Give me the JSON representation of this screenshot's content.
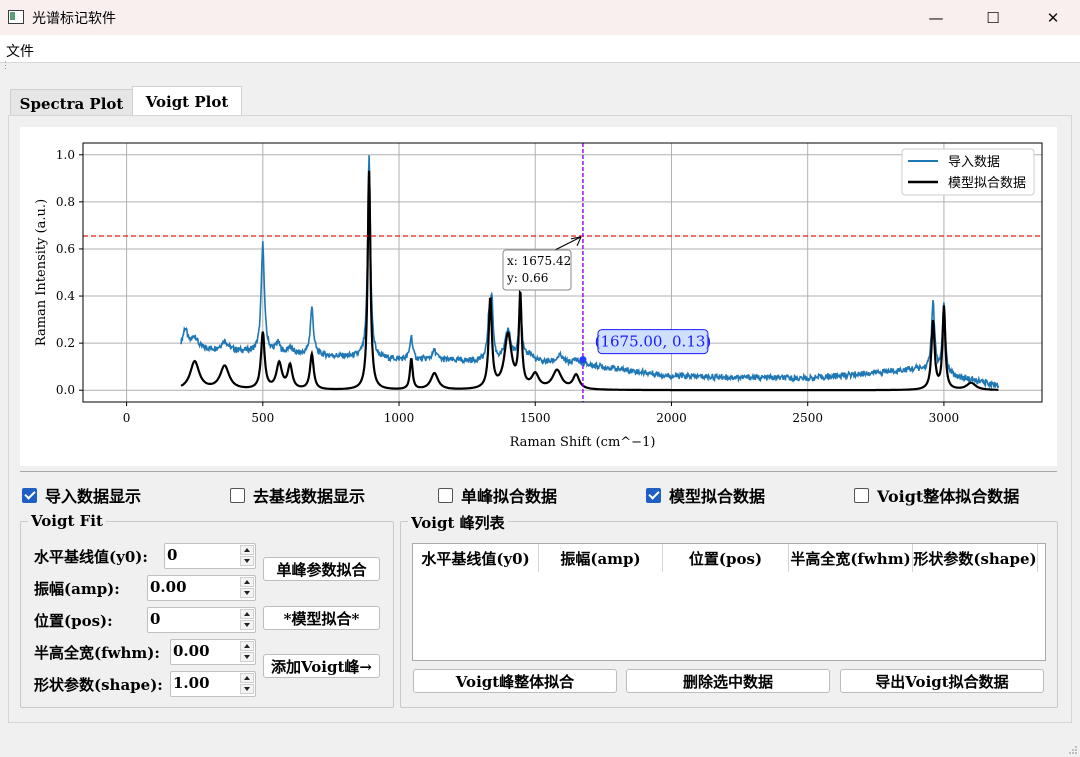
{
  "window": {
    "title": "光谱标记软件",
    "minimize": "—",
    "maximize": "☐",
    "close": "✕"
  },
  "menu": {
    "file": "文件"
  },
  "tabs": [
    {
      "label": "Spectra Plot"
    },
    {
      "label": "Voigt Plot"
    }
  ],
  "colors": {
    "raw": "#1f77b4",
    "fit": "#000000",
    "hline": "#e31a1c",
    "vline": "#8b00ff",
    "label_bg": "#cfe0ff",
    "label_fg": "#1a1aff",
    "checkbox": "#1f5fc4"
  },
  "chart_data": {
    "type": "line",
    "xlabel": "Raman Shift (cm^−1)",
    "ylabel": "Raman Intensity (a.u.)",
    "xlim": [
      -160,
      3360
    ],
    "ylim": [
      -0.05,
      1.05
    ],
    "xticks": [
      "0",
      "500",
      "1000",
      "1500",
      "2000",
      "2500",
      "3000"
    ],
    "yticks": [
      "0.0",
      "0.2",
      "0.4",
      "0.6",
      "0.8",
      "1.0"
    ],
    "grid": true,
    "legend_position": "top-right",
    "series": [
      {
        "name": "导入数据",
        "color": "#1f77b4",
        "baseline": [
          [
            200,
            0.18
          ],
          [
            500,
            0.16
          ],
          [
            1000,
            0.13
          ],
          [
            1500,
            0.12
          ],
          [
            1675,
            0.11
          ],
          [
            2000,
            0.06
          ],
          [
            2500,
            0.05
          ],
          [
            2900,
            0.09
          ],
          [
            3200,
            0.02
          ]
        ],
        "peaks": [
          [
            215,
            0.08,
            10
          ],
          [
            250,
            0.05,
            12
          ],
          [
            360,
            0.04,
            14
          ],
          [
            500,
            0.46,
            7
          ],
          [
            555,
            0.04,
            10
          ],
          [
            600,
            0.03,
            8
          ],
          [
            680,
            0.2,
            7
          ],
          [
            890,
            0.86,
            6
          ],
          [
            1045,
            0.1,
            6
          ],
          [
            1130,
            0.04,
            10
          ],
          [
            1330,
            0.15,
            6
          ],
          [
            1340,
            0.25,
            6
          ],
          [
            1400,
            0.13,
            12
          ],
          [
            1445,
            0.27,
            6
          ],
          [
            1480,
            0.03,
            12
          ],
          [
            1590,
            0.03,
            14
          ],
          [
            1650,
            0.02,
            10
          ],
          [
            2960,
            0.29,
            7
          ],
          [
            3000,
            0.3,
            6
          ]
        ]
      },
      {
        "name": "模型拟合数据",
        "color": "#000000",
        "peaks": [
          [
            250,
            0.12,
            20
          ],
          [
            360,
            0.1,
            20
          ],
          [
            500,
            0.24,
            8
          ],
          [
            560,
            0.11,
            12
          ],
          [
            600,
            0.1,
            10
          ],
          [
            680,
            0.15,
            8
          ],
          [
            890,
            0.93,
            6
          ],
          [
            1045,
            0.13,
            6
          ],
          [
            1130,
            0.07,
            16
          ],
          [
            1335,
            0.38,
            7
          ],
          [
            1400,
            0.23,
            16
          ],
          [
            1445,
            0.39,
            6
          ],
          [
            1500,
            0.06,
            16
          ],
          [
            1580,
            0.08,
            20
          ],
          [
            1650,
            0.06,
            14
          ],
          [
            2960,
            0.29,
            7
          ],
          [
            3000,
            0.35,
            6
          ],
          [
            3100,
            0.03,
            20
          ]
        ]
      }
    ],
    "hline_y": 0.655,
    "vline_x": 1675,
    "annotation": {
      "x": 1675.42,
      "y": 0.66,
      "line1": "x: 1675.42",
      "line2": "y: 0.66"
    },
    "marker": {
      "x": 1675.0,
      "y": 0.13,
      "label": "(1675.00, 0.13)"
    }
  },
  "checkboxes": [
    {
      "label": "导入数据显示",
      "checked": true
    },
    {
      "label": "去基线数据显示",
      "checked": false
    },
    {
      "label": "单峰拟合数据",
      "checked": false
    },
    {
      "label": "模型拟合数据",
      "checked": true
    },
    {
      "label": "Voigt整体拟合数据",
      "checked": false
    }
  ],
  "voigt_fit": {
    "title": "Voigt Fit",
    "fields": [
      {
        "label": "水平基线值(y0):",
        "value": "0"
      },
      {
        "label": "振幅(amp):",
        "value": "0.00"
      },
      {
        "label": "位置(pos):",
        "value": "0"
      },
      {
        "label": "半高全宽(fwhm):",
        "value": "0.00"
      },
      {
        "label": "形状参数(shape):",
        "value": "1.00"
      }
    ],
    "buttons": {
      "single": "单峰参数拟合",
      "model": "*模型拟合*",
      "add": "添加Voigt峰→"
    }
  },
  "peak_list": {
    "title": "Voigt 峰列表",
    "columns": [
      "水平基线值(y0)",
      "振幅(amp)",
      "位置(pos)",
      "半高全宽(fwhm)",
      "形状参数(shape)"
    ],
    "buttons": {
      "fit_all": "Voigt峰整体拟合",
      "delete": "删除选中数据",
      "export": "导出Voigt拟合数据"
    }
  }
}
